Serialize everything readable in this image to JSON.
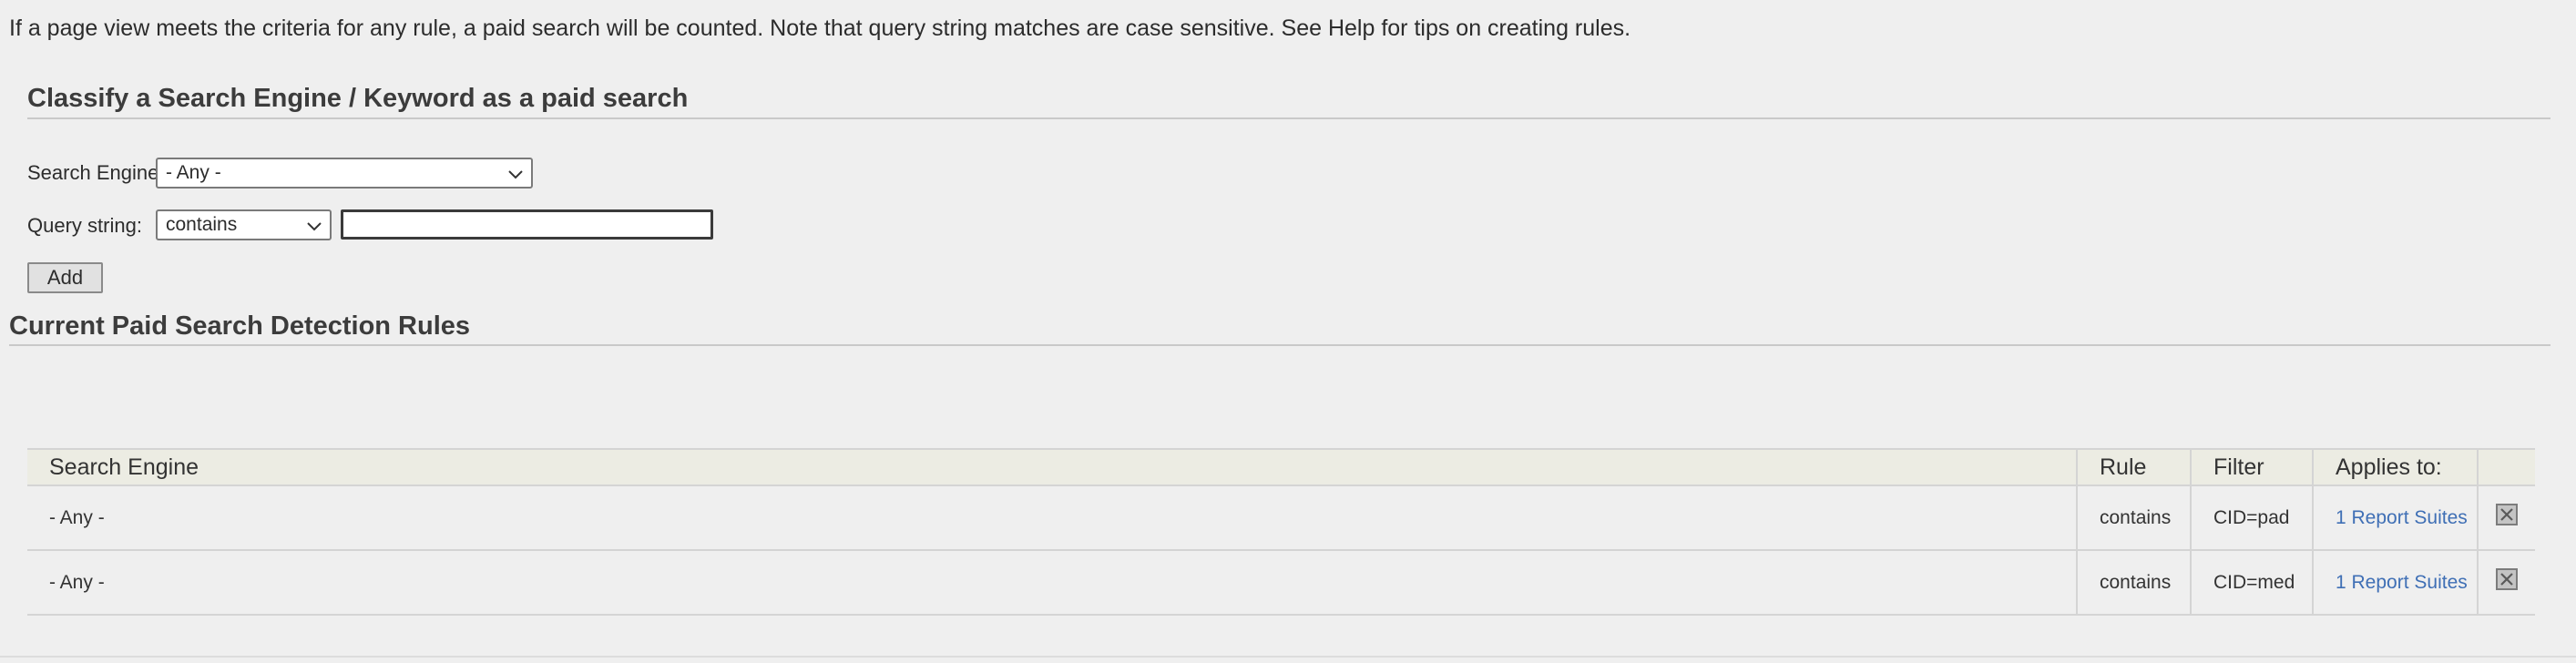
{
  "intro_text": "If a page view meets the criteria for any rule, a paid search will be counted. Note that query string matches are case sensitive. See Help for tips on creating rules.",
  "classify_section": {
    "title": "Classify a Search Engine / Keyword as a paid search",
    "search_engine_label": "Search Engine:",
    "search_engine_selected": "- Any -",
    "query_string_label": "Query string:",
    "query_operator_selected": "contains",
    "query_value": "",
    "add_button_label": "Add"
  },
  "rules_section": {
    "title": "Current Paid Search Detection Rules",
    "columns": [
      "Search Engine",
      "Rule",
      "Filter",
      "Applies to:"
    ],
    "rows": [
      {
        "search_engine": "- Any -",
        "rule": "contains",
        "filter": "CID=pad",
        "applies_to": "1 Report Suites"
      },
      {
        "search_engine": "- Any -",
        "rule": "contains",
        "filter": "CID=med",
        "applies_to": "1 Report Suites"
      }
    ],
    "delete_icon": "close-box-icon"
  },
  "colors": {
    "background": "#efefef",
    "link": "#3f6fb5",
    "table_header_bg": "#ecece3"
  }
}
